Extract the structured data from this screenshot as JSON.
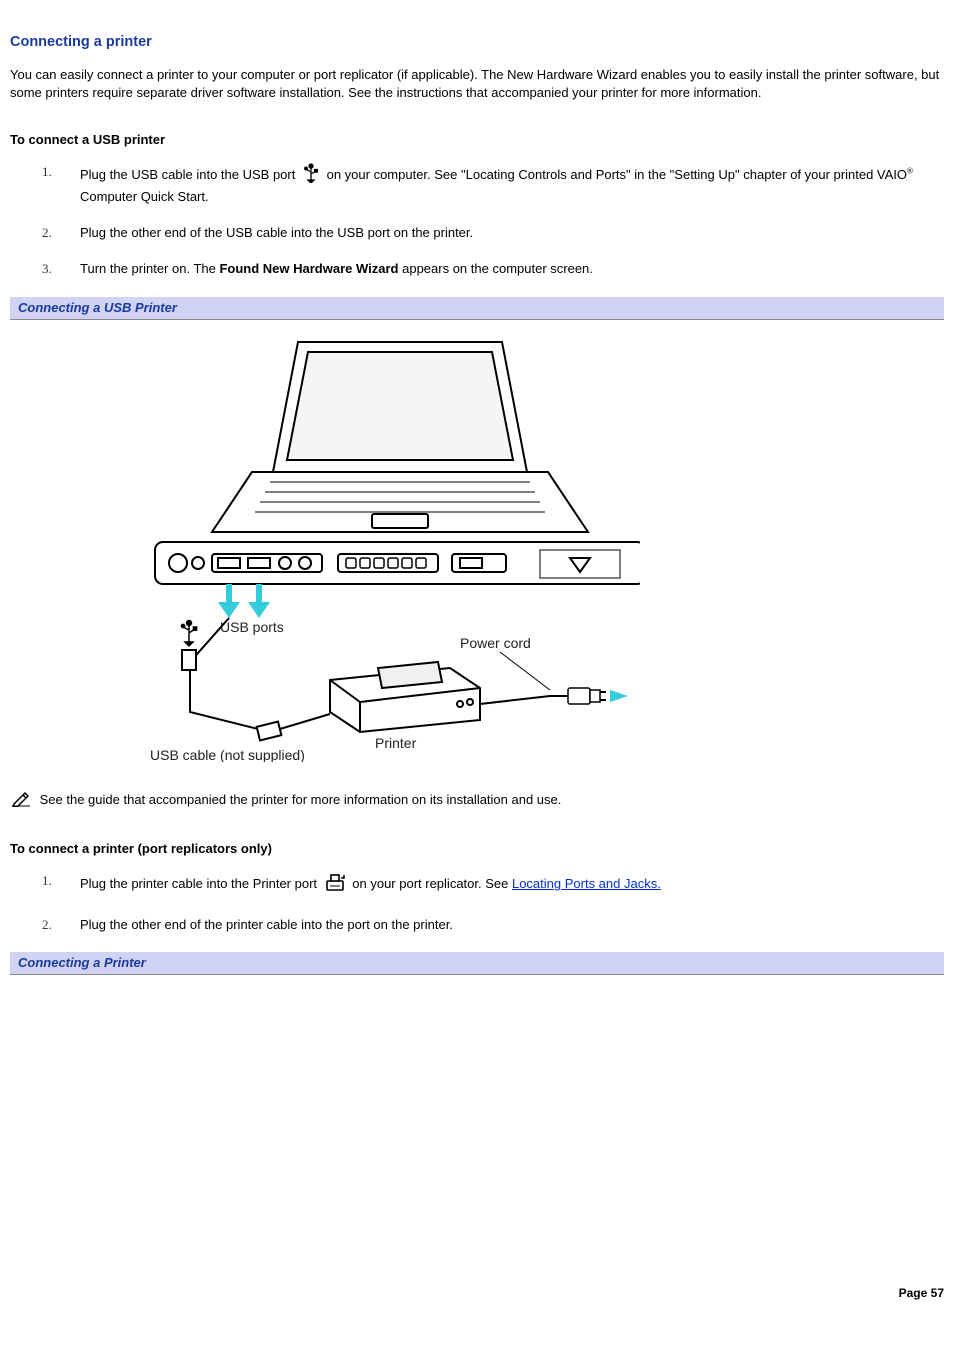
{
  "heading": "Connecting a printer",
  "intro": "You can easily connect a printer to your computer or port replicator (if applicable). The New Hardware Wizard enables you to easily install the printer software, but some printers require separate driver software installation. See the instructions that accompanied your printer for more information.",
  "usb": {
    "heading": "To connect a USB printer",
    "steps": {
      "s1a": "Plug the USB cable into the USB port ",
      "s1b": " on your computer. See \"Locating Controls and Ports\" in the \"Setting Up\" chapter of your printed VAIO",
      "s1c": " Computer Quick Start.",
      "reg": "®",
      "s2": "Plug the other end of the USB cable into the USB port on the printer.",
      "s3a": "Turn the printer on. The ",
      "s3bold": "Found New Hardware Wizard",
      "s3b": " appears on the computer screen."
    },
    "figure_title": "Connecting a USB Printer",
    "figure_labels": {
      "usb_ports": "USB ports",
      "power_cord": "Power cord",
      "printer": "Printer",
      "usb_cable": "USB cable (not supplied)"
    }
  },
  "note_text": " See the guide that accompanied the printer for more information on its installation and use.",
  "replicator": {
    "heading": "To connect a printer (port replicators only)",
    "steps": {
      "s1a": "Plug the printer cable into the Printer port ",
      "s1b": " on your port replicator. See ",
      "link": "Locating Ports and Jacks.",
      "s2": "Plug the other end of the printer cable into the port on the printer."
    },
    "figure_title": "Connecting a Printer"
  },
  "page_number": "Page 57"
}
